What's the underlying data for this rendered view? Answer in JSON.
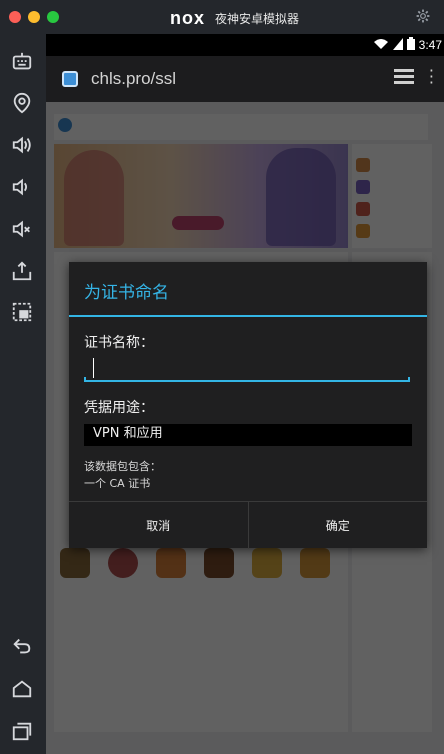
{
  "window": {
    "logo_text": "nox",
    "title": "夜神安卓模拟器",
    "settings_icon": "gear-icon"
  },
  "sidebar": {
    "icons": [
      "keyboard-icon",
      "location-icon",
      "volume-up-icon",
      "volume-down-icon",
      "mute-icon",
      "install-apk-icon",
      "screenshot-icon",
      "back-icon",
      "home-icon",
      "recent-apps-icon"
    ]
  },
  "status_bar": {
    "time": "3:47",
    "icons": [
      "wifi-icon",
      "signal-icon",
      "battery-icon"
    ]
  },
  "app_bar": {
    "url": "chls.pro/ssl",
    "icons": [
      "app-icon",
      "tabs-icon",
      "more-icon"
    ]
  },
  "dialog": {
    "title": "为证书命名",
    "name_label": "证书名称：",
    "name_value": "",
    "usage_label": "凭据用途：",
    "usage_value": "VPN 和应用",
    "info_line1": "该数据包包含：",
    "info_line2": "一个 CA 证书",
    "cancel": "取消",
    "ok": "确定"
  },
  "colors": {
    "accent": "#33b5e5",
    "dialog_bg": "#1f1f20",
    "toolbar_bg": "#24272c"
  }
}
